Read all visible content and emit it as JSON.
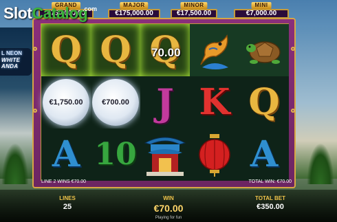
{
  "logo": {
    "part1": "Slot",
    "part2": "Catalog",
    "domain": ".com"
  },
  "side_sign": {
    "line1": "L NEON",
    "line2": "WHITE",
    "line3": "ANDA"
  },
  "jackpots": [
    {
      "label": "GRAND",
      "value": "€750,000.00"
    },
    {
      "label": "MAJOR",
      "value": "€175,000.00"
    },
    {
      "label": "MINOR",
      "value": "€17,500.00"
    },
    {
      "label": "MINI",
      "value": "€7,000.00"
    }
  ],
  "reels": {
    "win_overlay": "70.00",
    "cells": [
      [
        "Q",
        "Q",
        "Q",
        "fish-icon",
        "turtle-icon"
      ],
      [
        "€1,750.00",
        "€700.00",
        "J",
        "K",
        "Q"
      ],
      [
        "A",
        "10",
        "temple-icon",
        "lantern-icon",
        "A"
      ]
    ],
    "winning_positions": [
      "0-0",
      "0-1",
      "0-2"
    ]
  },
  "info_bar": {
    "line_win": "LINE 2 WINS €70.00",
    "total_win": "TOTAL WIN: €70.00"
  },
  "bottom": {
    "lines_label": "LINES",
    "lines_value": "25",
    "win_label": "WIN",
    "win_value": "€70.00",
    "bet_label": "TOTAL BET",
    "bet_value": "€350.00",
    "footer": "Playing for fun"
  },
  "colors": {
    "frame": "#8a2f7a",
    "gold": "#d8a644",
    "win_glow": "#b4ff3c"
  }
}
